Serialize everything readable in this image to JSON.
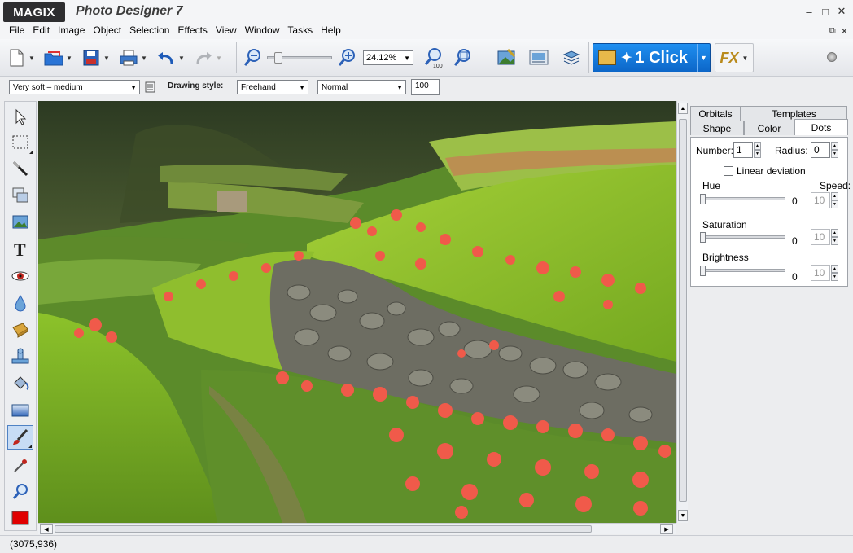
{
  "app": {
    "brand": "MAGIX",
    "title": "Photo Designer 7"
  },
  "window_controls": {
    "minimize": "–",
    "maximize": "□",
    "close": "✕"
  },
  "mdi_controls": {
    "restore": "⧉",
    "close": "✕"
  },
  "menu": [
    "File",
    "Edit",
    "Image",
    "Object",
    "Selection",
    "Effects",
    "View",
    "Window",
    "Tasks",
    "Help"
  ],
  "toolbar": {
    "zoom_value": "24.12%",
    "one_click_label": "1 Click",
    "fx_label": "FX",
    "accent_color": "#0c66c8"
  },
  "options": {
    "brush_preset": "Very soft – medium",
    "drawing_style_label": "Drawing style:",
    "drawing_style": "Freehand",
    "blend_mode": "Normal",
    "opacity": "100"
  },
  "tools": [
    "arrow-select-icon",
    "rectangle-selection-icon",
    "brush-stroke-icon",
    "object-layers-icon",
    "image-icon",
    "text-icon",
    "red-eye-icon",
    "water-drop-icon",
    "sponge-icon",
    "clone-stamp-icon",
    "fill-bucket-icon",
    "gradient-icon",
    "paint-brush-icon",
    "eyedropper-icon",
    "zoom-icon",
    "color-swatch-icon"
  ],
  "active_tool": "paint-brush-icon",
  "foreground_color": "#e00000",
  "panel": {
    "tabs_top": [
      "Orbitals",
      "Templates"
    ],
    "tabs_bottom": [
      "Shape",
      "Color",
      "Dots"
    ],
    "selected_tab": "Dots",
    "number_label": "Number:",
    "number_value": "1",
    "radius_label": "Radius:",
    "radius_value": "0",
    "linear_deviation_label": "Linear deviation",
    "speed_label": "Speed:",
    "hue_label": "Hue",
    "hue_value": "0",
    "hue_speed": "10",
    "saturation_label": "Saturation",
    "saturation_value": "0",
    "saturation_speed": "10",
    "brightness_label": "Brightness",
    "brightness_value": "0",
    "brightness_speed": "10"
  },
  "status": {
    "coordinates": "(3075,936)"
  }
}
